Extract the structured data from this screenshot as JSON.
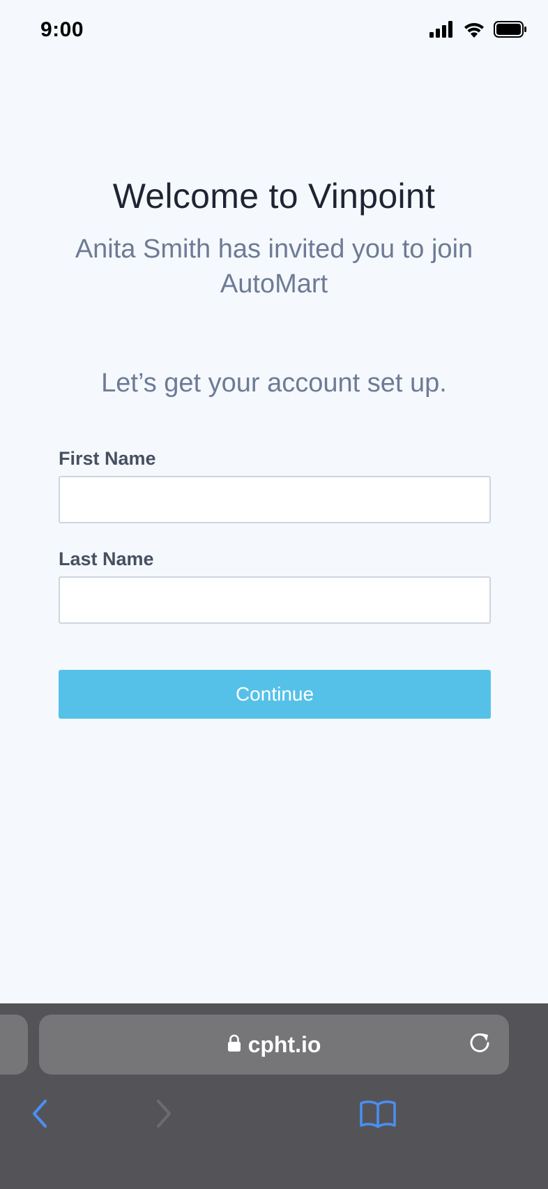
{
  "status_bar": {
    "time": "9:00",
    "icons": [
      "cellular-signal-icon",
      "wifi-icon",
      "battery-icon"
    ]
  },
  "welcome": {
    "title": "Welcome to Vinpoint",
    "invite_message": "Anita Smith has invited you to join AutoMart"
  },
  "form": {
    "heading": "Let’s get your account set up.",
    "first_name_label": "First Name",
    "first_name_value": "",
    "last_name_label": "Last Name",
    "last_name_value": "",
    "continue_label": "Continue"
  },
  "browser": {
    "url": "cpht.io",
    "icons": [
      "lock-icon",
      "reload-icon",
      "back-icon",
      "forward-icon",
      "bookmarks-icon"
    ]
  },
  "colors": {
    "background": "#f5f9fd",
    "title_text": "#1f2433",
    "muted_text": "#6e7b95",
    "label_text": "#474f60",
    "accent_button": "#56c1e8",
    "browser_chrome": "#545458",
    "browser_link_blue": "#4a8ff5"
  }
}
